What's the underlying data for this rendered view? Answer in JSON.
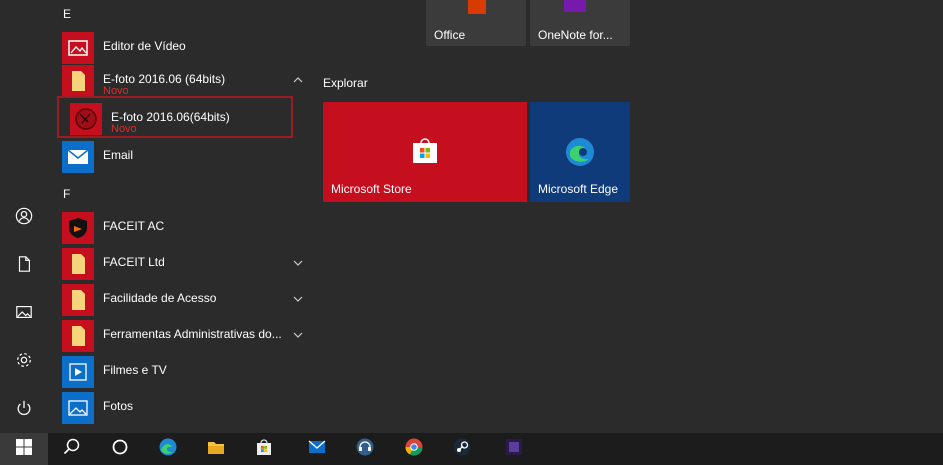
{
  "applist": {
    "letter_e": "E",
    "letter_f": "F",
    "items": [
      {
        "label": "Editor de Vídeo",
        "sub": ""
      },
      {
        "label": "E-foto 2016.06 (64bits)",
        "sub": "Novo"
      },
      {
        "label": "E-foto 2016.06(64bits)",
        "sub": "Novo"
      },
      {
        "label": "Email",
        "sub": ""
      },
      {
        "label": "FACEIT AC",
        "sub": ""
      },
      {
        "label": "FACEIT Ltd",
        "sub": ""
      },
      {
        "label": "Facilidade de Acesso",
        "sub": ""
      },
      {
        "label": "Ferramentas Administrativas do...",
        "sub": ""
      },
      {
        "label": "Filmes e TV",
        "sub": ""
      },
      {
        "label": "Fotos",
        "sub": ""
      }
    ]
  },
  "tiles": {
    "top": [
      {
        "label": "Office"
      },
      {
        "label": "OneNote for..."
      }
    ],
    "section_title": "Explorar",
    "store": {
      "label": "Microsoft Store",
      "color": "#c50f1f"
    },
    "edge": {
      "label": "Microsoft Edge",
      "color": "#0f3b7a"
    }
  },
  "rail": {
    "icons": [
      "user-icon",
      "document-icon",
      "pictures-icon",
      "settings-icon",
      "power-icon"
    ]
  },
  "taskbar": {
    "icons": [
      "windows-start-icon",
      "search-icon",
      "cortana-icon",
      "edge-icon",
      "file-explorer-icon",
      "store-icon",
      "mail-icon",
      "faceit-icon",
      "chrome-icon",
      "steam-icon",
      "app-icon"
    ]
  },
  "colors": {
    "new_badge": "#e02a2a",
    "highlight_border": "#9b1c22",
    "app_tile_red": "#c50f1f",
    "mail_blue": "#0b6fc9"
  }
}
